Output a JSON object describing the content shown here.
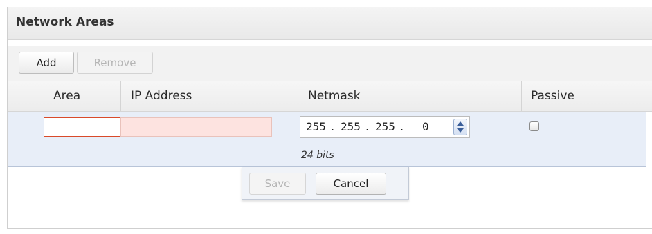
{
  "panel": {
    "title": "Network Areas"
  },
  "toolbar": {
    "add_label": "Add",
    "remove_label": "Remove"
  },
  "columns": [
    "Area",
    "IP Address",
    "Netmask",
    "Passive"
  ],
  "edit_row": {
    "area_value": "",
    "ip_value": "",
    "netmask": {
      "octets": [
        "255",
        "255",
        "255",
        "0"
      ],
      "separator": ".",
      "bits_label": "24 bits"
    },
    "passive_checked": false
  },
  "actions": {
    "save_label": "Save",
    "cancel_label": "Cancel"
  },
  "colors": {
    "invalid_border": "#d94a2a",
    "invalid_fill": "#fde3e0",
    "edit_row_bg": "#e8eef8"
  }
}
